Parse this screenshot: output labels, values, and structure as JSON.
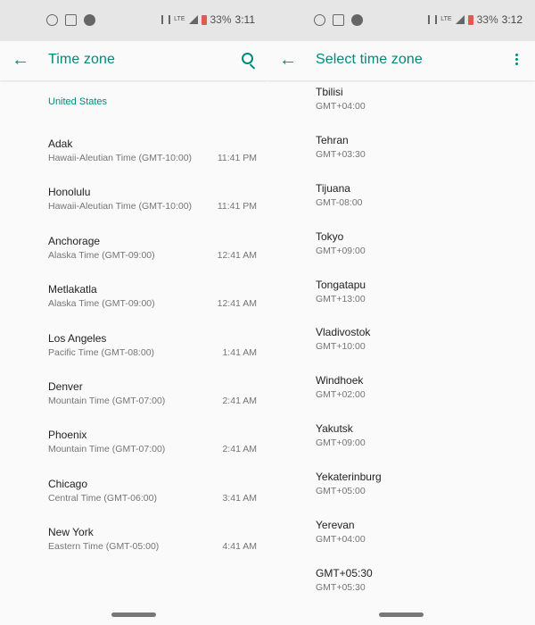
{
  "left": {
    "status": {
      "battery": "33%",
      "time": "3:11"
    },
    "title": "Time zone",
    "section": "United States",
    "zones": [
      {
        "name": "Adak",
        "desc": "Hawaii-Aleutian Time (GMT-10:00)",
        "time": "11:41 PM"
      },
      {
        "name": "Honolulu",
        "desc": "Hawaii-Aleutian Time (GMT-10:00)",
        "time": "11:41 PM"
      },
      {
        "name": "Anchorage",
        "desc": "Alaska Time (GMT-09:00)",
        "time": "12:41 AM"
      },
      {
        "name": "Metlakatla",
        "desc": "Alaska Time (GMT-09:00)",
        "time": "12:41 AM"
      },
      {
        "name": "Los Angeles",
        "desc": "Pacific Time (GMT-08:00)",
        "time": "1:41 AM"
      },
      {
        "name": "Denver",
        "desc": "Mountain Time (GMT-07:00)",
        "time": "2:41 AM"
      },
      {
        "name": "Phoenix",
        "desc": "Mountain Time (GMT-07:00)",
        "time": "2:41 AM"
      },
      {
        "name": "Chicago",
        "desc": "Central Time (GMT-06:00)",
        "time": "3:41 AM"
      },
      {
        "name": "New York",
        "desc": "Eastern Time (GMT-05:00)",
        "time": "4:41 AM"
      }
    ]
  },
  "right": {
    "status": {
      "battery": "33%",
      "time": "3:12"
    },
    "title": "Select time zone",
    "zones": [
      {
        "name": "Tbilisi",
        "offset": "GMT+04:00"
      },
      {
        "name": "Tehran",
        "offset": "GMT+03:30"
      },
      {
        "name": "Tijuana",
        "offset": "GMT-08:00"
      },
      {
        "name": "Tokyo",
        "offset": "GMT+09:00"
      },
      {
        "name": "Tongatapu",
        "offset": "GMT+13:00"
      },
      {
        "name": "Vladivostok",
        "offset": "GMT+10:00"
      },
      {
        "name": "Windhoek",
        "offset": "GMT+02:00"
      },
      {
        "name": "Yakutsk",
        "offset": "GMT+09:00"
      },
      {
        "name": "Yekaterinburg",
        "offset": "GMT+05:00"
      },
      {
        "name": "Yerevan",
        "offset": "GMT+04:00"
      },
      {
        "name": "GMT+05:30",
        "offset": "GMT+05:30"
      }
    ]
  },
  "colors": {
    "accent": "#00897b",
    "statusbar": "#e6e6e6",
    "background": "#fafafa"
  }
}
